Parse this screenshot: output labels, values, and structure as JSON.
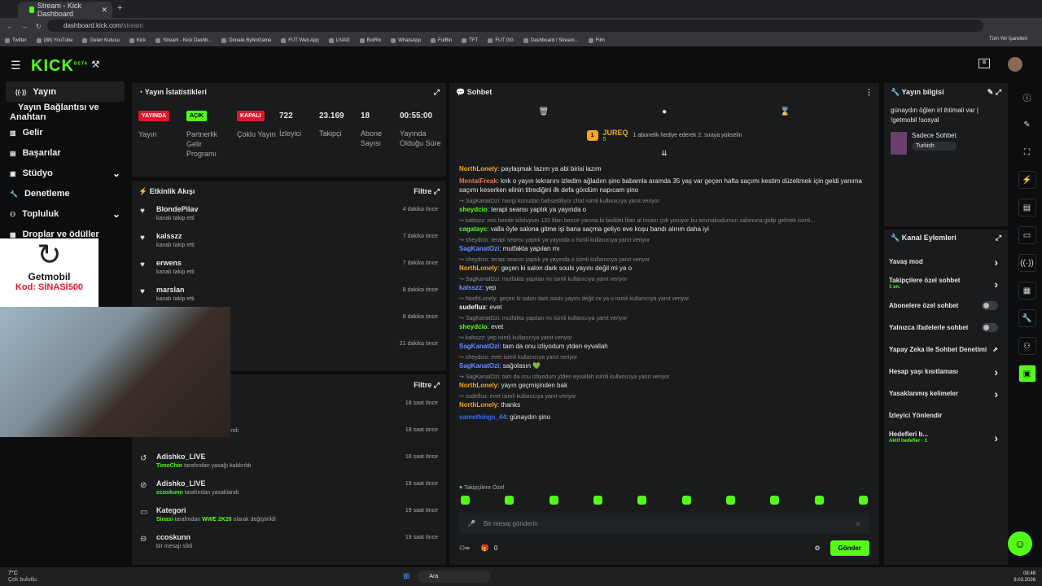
{
  "browser": {
    "tab_title": "Stream - Kick Dashboard",
    "url_host": "dashboard.kick.com",
    "url_path": "/stream",
    "bookmarks": [
      "Twitter",
      "(88) YouTube",
      "Gelen Kutusu",
      "Kick",
      "Stream - Kick Dashb...",
      "Donate ByNoGame",
      "FUT Web App",
      "LIVAD",
      "BotRix",
      "WhatsApp",
      "FutBin",
      "TFT",
      "FUT GG",
      "Dashboard / Stream...",
      "Film"
    ],
    "all_bookmarks": "Tüm Yer İşaretleri"
  },
  "logo": "KICK",
  "logo_beta": "BETA",
  "sidebar": {
    "items": [
      {
        "label": "Yayın",
        "icon": "broadcast-icon"
      },
      {
        "label": "Yayın Bağlantısı ve Anahtarı",
        "icon": ""
      },
      {
        "label": "Gelir",
        "icon": "income-icon"
      },
      {
        "label": "Başarılar",
        "icon": "achievement-icon"
      },
      {
        "label": "Stüdyo",
        "icon": "studio-icon",
        "chevron": true
      },
      {
        "label": "Denetleme",
        "icon": "moderation-icon"
      },
      {
        "label": "Topluluk",
        "icon": "community-icon",
        "chevron": true
      },
      {
        "label": "Droplar ve ödüller",
        "icon": "drops-icon"
      }
    ]
  },
  "stats": {
    "title": "Yayın İstatistikleri",
    "cols": [
      {
        "badge": "YAYINDA",
        "badge_color": "#e0162b",
        "label": "Yayın"
      },
      {
        "badge": "AÇIK",
        "badge_color": "#53fc18",
        "label": "Partnerlik Gelir Programı"
      },
      {
        "badge": "KAPALI",
        "badge_color": "#e0162b",
        "label": "Çoklu Yayın"
      },
      {
        "value": "722",
        "label": "İzleyici"
      },
      {
        "value": "23.169",
        "label": "Takipçi"
      },
      {
        "value": "18",
        "label": "Abone Sayısı"
      },
      {
        "value": "00:55:00",
        "label": "Yayında Olduğu Süre"
      }
    ]
  },
  "activity": {
    "title": "Etkinlik Akışı",
    "filter": "Filtre",
    "items": [
      {
        "name": "BlondePilav",
        "sub": "kanalı takip etti",
        "time": "4 dakika önce"
      },
      {
        "name": "kalsszz",
        "sub": "kanalı takip etti",
        "time": "7 dakika önce"
      },
      {
        "name": "erwens",
        "sub": "kanalı takip etti",
        "time": "7 dakika önce"
      },
      {
        "name": "marslan",
        "sub": "kanalı takip etti",
        "time": "8 dakika önce"
      },
      {
        "name": "",
        "sub": "",
        "time": "8 dakika önce"
      },
      {
        "name": "",
        "sub": "",
        "time": "21 dakika önce"
      }
    ]
  },
  "modlog": {
    "filter": "Filtre",
    "items": [
      {
        "name": "",
        "hl": "atting",
        "sub": "olarak değiştirildi",
        "time": "18 saat önce"
      },
      {
        "name": "",
        "hl": "TimoChin",
        "sub": "tarafından yasaklandı",
        "time": "18 saat önce"
      },
      {
        "name": "Adishko_LIVE",
        "hl": "TimoChin",
        "sub": "tarafından yasağı kaldırıldı",
        "time": "18 saat önce"
      },
      {
        "name": "Adishko_LIVE",
        "hl": "ccoskunn",
        "sub": "tarafından yasaklandı",
        "time": "18 saat önce"
      },
      {
        "name": "Kategori",
        "hl": "Sinasi",
        "sub": "tarafından",
        "hl2": "WWE 2K26",
        "sub2": "olarak değiştirildi",
        "time": "19 saat önce"
      },
      {
        "name": "ccoskunn",
        "hl": "",
        "sub": "bir mesajı sildi",
        "time": "19 saat önce"
      }
    ]
  },
  "chat": {
    "title": "Sohbet",
    "top_user": "JUREQ",
    "top_rank": "1",
    "top_gifts": "5",
    "top_note": "1 abonelik hediye ederek 2. sıraya yükselin",
    "messages": [
      {
        "user": "NorthLonely",
        "color": "#f5a623",
        "text": "paylaşmak lazım ya abi birisi lazım"
      },
      {
        "user": "MentalFreak",
        "color": "#e8734a",
        "text": "knk o yayın tekrarını izledim ağladım şino babamla aramda 35 yaş var geçen hafta saçımı kestim düzeltmek için geldi yanıma saçımı keserken elinin titrediğini ilk defa gördüm napıcam şino"
      },
      {
        "reply": "SagKanatOzi: hangi konudan bahsediliyor chat isimli kullanıcıya yanıt veriyor",
        "user": "sheydcio",
        "color": "#53fc18",
        "text": "terapi seansı yaptık ya yayında o"
      },
      {
        "reply": "kalsszz: reis bende kiloluyum 132 filan bence yanına bi bisiklet filan al insanı çok yoruyor bu amınakodumun salonuna gidip gelmek isimli...",
        "user": "cagatayc",
        "color": "#53fc18",
        "text": "valla öyle salona gitme işi bana saçma geliyo eve koşu bandı alırım daha iyi"
      },
      {
        "reply": "sheydcio: terapi seansı yaptık ya yayında o isimli kullanıcıya yanıt veriyor",
        "user": "SagKanatOzi",
        "color": "#6b8cff",
        "text": "mutfakta yapılan mı"
      },
      {
        "reply": "sheydcio: terapi seansı yaptık ya yayında o isimli kullanıcıya yanıt veriyor",
        "user": "NorthLonely",
        "color": "#f5a623",
        "text": "geçen ki salon dark souls yayını değil mi ya o"
      },
      {
        "reply": "SagKanatOzi: mutfakta yapılan mı isimli kullanıcıya yanıt veriyor",
        "user": "kalsszz",
        "color": "#6b8cff",
        "text": "yep"
      },
      {
        "reply": "NorthLonely: geçen ki salon dark souls yayını değil mi ya o isimli kullanıcıya yanıt veriyor",
        "user": "sudeflux",
        "color": "#f5f5f5",
        "text": "evet"
      },
      {
        "reply": "SagKanatOzi: mutfakta yapılan mı isimli kullanıcıya yanıt veriyor",
        "user": "sheydcio",
        "color": "#53fc18",
        "text": "evet"
      },
      {
        "reply": "kalsszz: yep isimli kullanıcıya yanıt veriyor",
        "user": "SagKanatOzi",
        "color": "#6b8cff",
        "text": "tam da onu izliyodum ytden eyvallah"
      },
      {
        "reply": "sheydcio: evet isimli kullanıcıya yanıt veriyor",
        "user": "SagKanatOzi",
        "color": "#6b8cff",
        "text": "sağolasın 💚"
      },
      {
        "reply": "SagKanatOzi: tam da onu izliyodum ytden eyvallah isimli kullanıcıya yanıt veriyor",
        "user": "NorthLonely",
        "color": "#f5a623",
        "text": "yayın geçmişinden bak"
      },
      {
        "reply": "sudeflux: evet isimli kullanıcıya yanıt veriyor",
        "user": "NorthLonely",
        "color": "#f5a623",
        "text": "thanks"
      },
      {
        "user": "samethings_44",
        "color": "#3b6bff",
        "text": "günaydın şino"
      }
    ],
    "emote_label": "Takipçilere Özel",
    "placeholder": "Bir mesaj gönderin",
    "send": "Gönder",
    "points": "0"
  },
  "info": {
    "title": "Yayın bilgisi",
    "stream_title": "günaydın öğlen irl ihtimali var | !getmobil !sosyal",
    "category": "Sadece Sohbet",
    "language": "Turkish"
  },
  "channel_actions": {
    "title": "Kanal Eylemleri",
    "items": [
      {
        "label": "Yavaş mod",
        "type": "chevron"
      },
      {
        "label": "Takipçilere özel sohbet",
        "sub": "1 sn.",
        "type": "chevron"
      },
      {
        "label": "Abonelere özel sohbet",
        "type": "toggle"
      },
      {
        "label": "Yalnızca ifadelerle sohbet",
        "type": "toggle"
      },
      {
        "label": "Yapay Zeka ile Sohbet Denetimi",
        "type": "external"
      },
      {
        "label": "Hesap yaşı kısıtlaması",
        "type": "chevron"
      },
      {
        "label": "Yasaklanmış kelimeler",
        "type": "chevron"
      },
      {
        "label": "İzleyici Yönlendir",
        "type": "none"
      },
      {
        "label": "Hedefleri b...",
        "sub": "Aktif hedefler · 1",
        "type": "chevron"
      }
    ]
  },
  "overlay": {
    "promo_brand": "Getmobil",
    "promo_code": "Kod: SİNASİ500"
  },
  "taskbar": {
    "weather_temp": "7°C",
    "weather_desc": "Çok bulutlu",
    "search": "Ara",
    "time": "08:48",
    "date": "9.03.2026"
  }
}
